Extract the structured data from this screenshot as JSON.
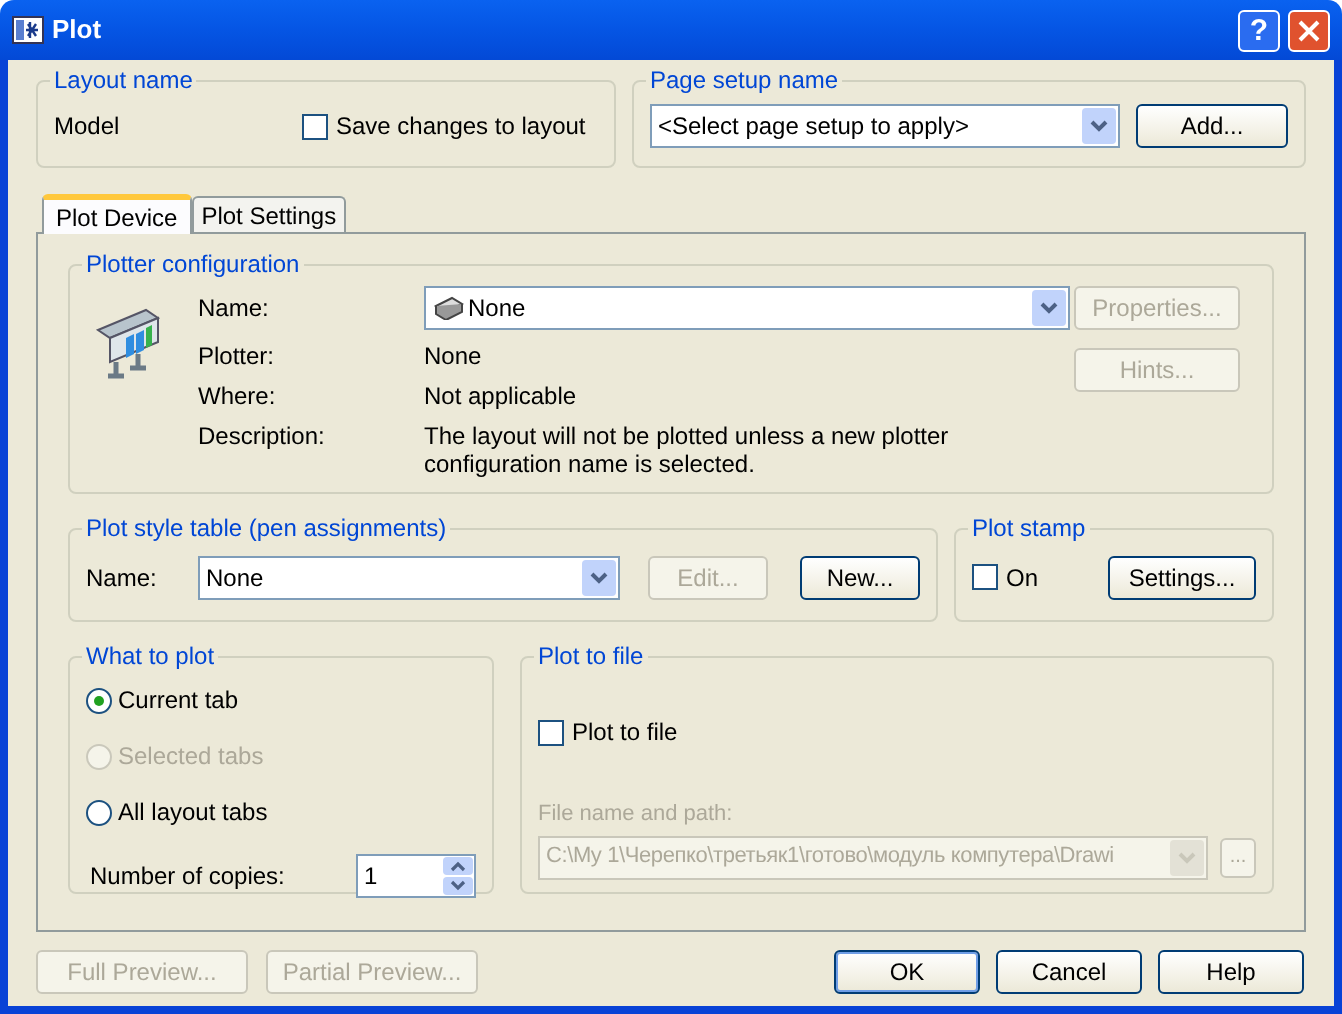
{
  "window": {
    "title": "Plot",
    "help_button": "?"
  },
  "layout_name": {
    "title": "Layout name",
    "value": "Model",
    "save_changes": {
      "label": "Save changes to layout",
      "checked": false
    }
  },
  "page_setup": {
    "title": "Page setup name",
    "select_value": "<Select page setup to apply>",
    "add_button": {
      "label": "Add...",
      "disabled": false
    }
  },
  "tabs": [
    {
      "label": "Plot Device",
      "selected": true
    },
    {
      "label": "Plot Settings",
      "selected": false
    }
  ],
  "plotter_configuration": {
    "title": "Plotter configuration",
    "fields": [
      {
        "label": "Name:",
        "kind": "select",
        "value": "None"
      },
      {
        "label": "Plotter:",
        "kind": "text",
        "value": "None"
      },
      {
        "label": "Where:",
        "kind": "text",
        "value": "Not applicable"
      },
      {
        "label": "Description:",
        "kind": "text",
        "value": "The layout will not be plotted unless a new plotter configuration name is selected."
      }
    ],
    "buttons": [
      {
        "label": "Properties...",
        "disabled": true
      },
      {
        "label": "Hints...",
        "disabled": true
      }
    ]
  },
  "plot_style_table": {
    "title": "Plot style table (pen assignments)",
    "name_label": "Name:",
    "select_value": "None",
    "buttons": [
      {
        "label": "Edit...",
        "disabled": true
      },
      {
        "label": "New...",
        "disabled": false
      }
    ]
  },
  "plot_stamp": {
    "title": "Plot stamp",
    "on": {
      "label": "On",
      "checked": false
    },
    "settings_button": {
      "label": "Settings...",
      "disabled": false
    }
  },
  "what_to_plot": {
    "title": "What to plot",
    "options": [
      {
        "label": "Current tab",
        "selected": true,
        "disabled": false
      },
      {
        "label": "Selected tabs",
        "selected": false,
        "disabled": true
      },
      {
        "label": "All layout tabs",
        "selected": false,
        "disabled": false
      }
    ],
    "copies": {
      "label": "Number of copies:",
      "value": "1"
    }
  },
  "plot_to_file": {
    "title": "Plot to file",
    "checkbox": {
      "label": "Plot to file",
      "checked": false
    },
    "path_label": "File name and path:",
    "path": {
      "value": "C:\\My 1\\Черепко\\третьяк1\\готово\\модуль компутера\\Drawi",
      "disabled": true
    },
    "browse_button": {
      "label": "...",
      "disabled": true
    }
  },
  "footer_buttons": [
    {
      "label": "Full Preview...",
      "disabled": true,
      "default": false
    },
    {
      "label": "Partial Preview...",
      "disabled": true,
      "default": false
    },
    {
      "label": "OK",
      "disabled": false,
      "default": true
    },
    {
      "label": "Cancel",
      "disabled": false,
      "default": false
    },
    {
      "label": "Help",
      "disabled": false,
      "default": false
    }
  ]
}
